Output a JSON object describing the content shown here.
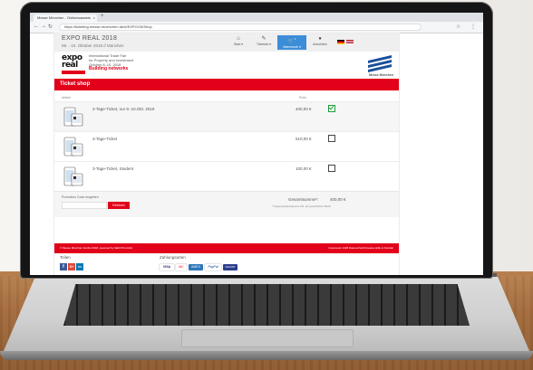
{
  "browser": {
    "tab_title": "Messe München - Onlineausweis",
    "url": "https://ticketing.messe-muenchen.de/#/EXPO/19/Shop"
  },
  "site": {
    "brand_title": "EXPO REAL 2018",
    "brand_subtitle": "08. - 10. Oktober 2018 // München",
    "nav": [
      {
        "label": "Start ▾",
        "icon": "home-icon"
      },
      {
        "label": "Ticketart ▾",
        "icon": "ticket-icon"
      },
      {
        "label": "Warenkorb ▾",
        "icon": "cart-icon"
      },
      {
        "label": "Anmelden",
        "icon": "user-icon"
      }
    ],
    "cart_count": "1",
    "fair_lines": [
      "International Trade Fair",
      "for Property and Investment",
      "October 8–10, 2018"
    ],
    "fair_tagline": "Building networks",
    "organizer": "Messe München",
    "logo_text": [
      "expo",
      "real"
    ]
  },
  "shop": {
    "title": "Ticket shop",
    "col_article": "Artikel",
    "col_price": "Preis",
    "tickets": [
      {
        "name": "2-Tage-Ticket, nur 9.-10.Okt. 2018",
        "price": "400,00 €",
        "checked": true
      },
      {
        "name": "3-Tage-Ticket",
        "price": "510,00 €",
        "checked": false
      },
      {
        "name": "3-Tage-Ticket, Student",
        "price": "100,00 €",
        "checked": false
      }
    ],
    "promo_label": "Promotion Code eingeben",
    "promo_button": "Einlösen",
    "total_label": "Gesamtsumme*:",
    "total_value": "400,00 €",
    "vat_note": "* Angezeigt Einzelpreise inkl. der gesetzlichen MwSt.",
    "next_button": "Weiter"
  },
  "footer": {
    "copyright": "© Messe München GmbH 2018, powered by GEFOS GmbH",
    "links": "Impressum   AGB   Datenschutzhinweise   Hilfe & Kontakt",
    "social_title": "Teilen",
    "payment_title": "Zahlungsarten",
    "social": [
      "f",
      "G+",
      "in"
    ],
    "payments": [
      "VISA",
      "MC",
      "AMEX",
      "PayPal",
      "SOFORT"
    ]
  }
}
